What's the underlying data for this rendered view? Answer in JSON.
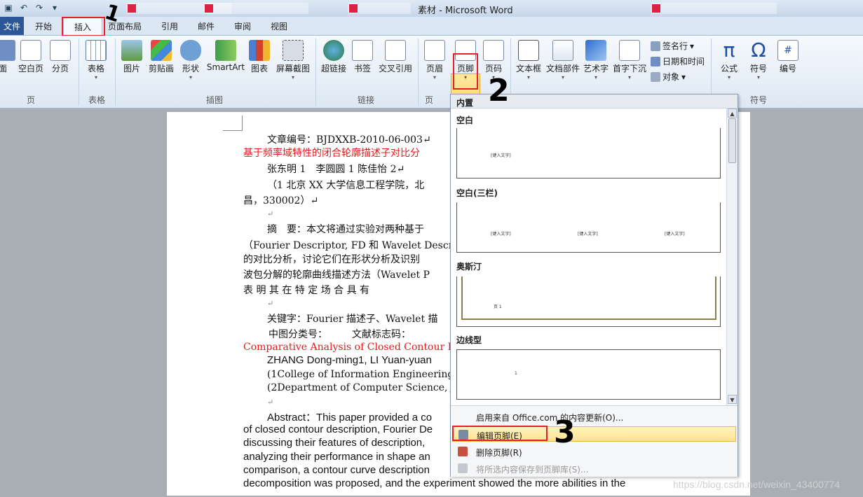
{
  "window": {
    "title": "素材 - Microsoft Word"
  },
  "tabs": {
    "file": "文件",
    "home": "开始",
    "insert": "插入",
    "layout": "页面布局",
    "references": "引用",
    "mailings": "邮件",
    "review": "审阅",
    "view": "视图"
  },
  "ribbon": {
    "pages": {
      "cover": "面",
      "blank": "空白页",
      "break": "分页",
      "group": "页"
    },
    "table": {
      "table": "表格",
      "group": "表格"
    },
    "illustrations": {
      "picture": "图片",
      "clipart": "剪贴画",
      "shapes": "形状",
      "smartart": "SmartArt",
      "chart": "图表",
      "screenshot": "屏幕截图",
      "group": "插图"
    },
    "links": {
      "hyperlink": "超链接",
      "bookmark": "书签",
      "crossref": "交叉引用",
      "group": "链接"
    },
    "headerfooter": {
      "header": "页眉",
      "footer": "页脚",
      "pagenum": "页码",
      "group": "页"
    },
    "text": {
      "textbox": "文本框",
      "quickparts": "文档部件",
      "wordart": "艺术字",
      "dropcap": "首字下沉",
      "signature": "签名行",
      "datetime": "日期和时间",
      "object": "对象"
    },
    "symbols": {
      "equation": "公式",
      "symbol": "符号",
      "number": "编号",
      "group": "符号"
    }
  },
  "document": {
    "lines": [
      "文章编号：BJDXXB-2010-06-003↵",
      "基于频率域特性的闭合轮廓描述子对比分",
      "张东明 1　李圆圆 1 陈佳怡 2↵",
      "（1 北京 XX 大学信息工程学院，北",
      "昌，330002）↵",
      "↵",
      "摘　要：本文将通过实验对两种基于",
      "（Fourier Descriptor, FD 和 Wavelet Descr",
      "的对比分析，讨论它们在形状分析及识别",
      "波包分解的轮廓曲线描述方法（Wavelet P",
      "表 明 其 在 特 定 场 合 具 有",
      "↵",
      "关键字：Fourier 描述子、Wavelet 描",
      "中图分类号：　　　文献标志码：",
      "Comparative Analysis of Closed Contour De",
      "ZHANG Dong-ming1, LI Yuan-yuan",
      "(1College of Information Engineering,",
      "(2Department of Computer Science, Ji",
      "↵",
      "Abstract：This paper provided a co",
      "of closed contour description, Fourier De",
      "discussing their features of description,",
      "analyzing their performance in shape an",
      "comparison, a contour curve description",
      "decomposition was proposed, and the experiment showed the more abilities in the"
    ]
  },
  "gallery": {
    "header": "内置",
    "items": [
      {
        "title": "空白",
        "placeholders": [
          "[键入文字]"
        ]
      },
      {
        "title": "空白(三栏)",
        "placeholders": [
          "[键入文字]",
          "[键入文字]",
          "[键入文字]"
        ]
      },
      {
        "title": "奥斯汀",
        "placeholders": [
          "页 1"
        ]
      },
      {
        "title": "边线型",
        "placeholders": [
          "1"
        ]
      }
    ],
    "menu": [
      {
        "label": "启用来自 Office.com 的内容更新(O)..."
      },
      {
        "label": "编辑页脚(E)"
      },
      {
        "label": "删除页脚(R)"
      },
      {
        "label": "将所选内容保存到页脚库(S)..."
      }
    ]
  },
  "annotations": {
    "step1": "1",
    "step2": "2",
    "step3": "3"
  },
  "watermark": "https://blog.csdn.net/weixin_43400774"
}
